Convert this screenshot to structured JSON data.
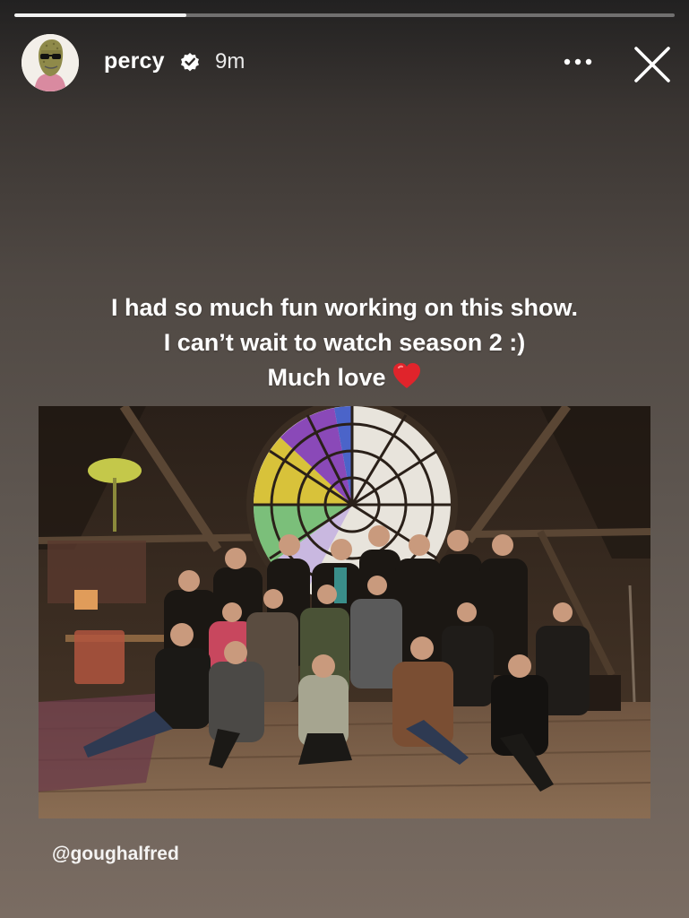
{
  "story": {
    "progress_fraction": 0.26
  },
  "header": {
    "username": "percy",
    "time_ago": "9m",
    "avatar_icon": "avatar-image",
    "verified_icon": "verified-badge-icon",
    "more_icon": "more-dots-icon",
    "close_icon": "close-icon"
  },
  "caption": {
    "line1": "I had so much fun working on this show.",
    "line2": "I can’t wait to watch season 2 :)",
    "line3": "Much love",
    "emoji": "heart-icon"
  },
  "photo": {
    "credit": "@goughalfred"
  },
  "colors": {
    "verified_blue": "#ffffff",
    "heart_red": "#e0242b"
  }
}
